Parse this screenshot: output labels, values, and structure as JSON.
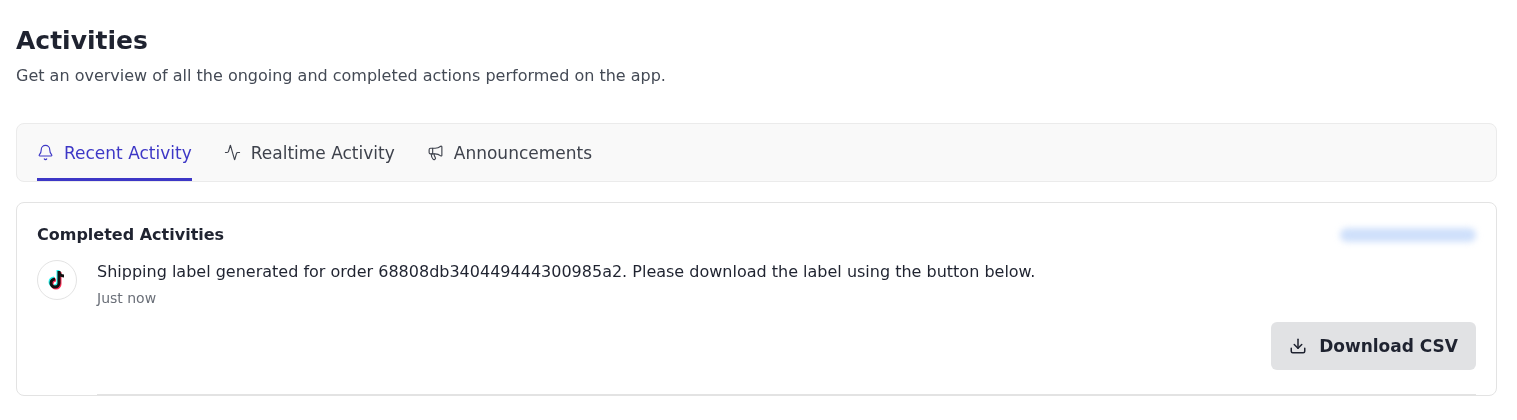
{
  "header": {
    "title": "Activities",
    "subtitle": "Get an overview of all the ongoing and completed actions performed on the app."
  },
  "tabs": [
    {
      "label": "Recent Activity",
      "selected": true
    },
    {
      "label": "Realtime Activity",
      "selected": false
    },
    {
      "label": "Announcements",
      "selected": false
    }
  ],
  "panel": {
    "title": "Completed Activities",
    "activities": [
      {
        "message": "Shipping label generated for order 68808db340449444300985a2. Please download the label using the button below.",
        "time": "Just now",
        "action": "Download CSV"
      }
    ]
  }
}
